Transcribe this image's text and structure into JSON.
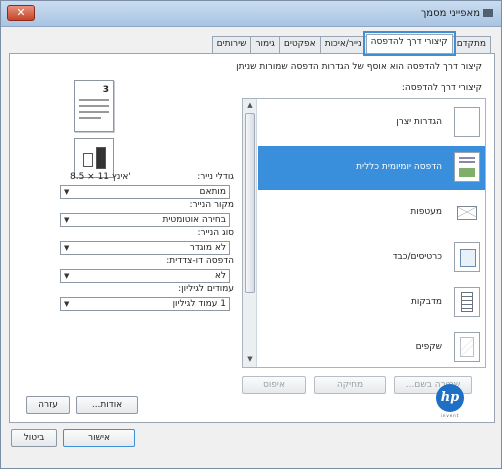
{
  "window": {
    "title": "מאפייני מסמך",
    "close_label": "✕"
  },
  "tabs": [
    {
      "label": "מתקדם"
    },
    {
      "label": "קיצורי דרך להדפסה",
      "active": true
    },
    {
      "label": "נייר/איכות"
    },
    {
      "label": "אפקטים"
    },
    {
      "label": "גימור"
    },
    {
      "label": "שירותים"
    }
  ],
  "panel": {
    "description": "קיצור דרך להדפסה הוא אוסף של הגדרות הדפסה שמורות שניתן",
    "list_label": "קיצורי דרך להדפסה:"
  },
  "shortcuts": [
    {
      "label": "הגדרות יצרן",
      "icon": "blank-page-icon"
    },
    {
      "label": "הדפסה יומיומית כללית",
      "icon": "general-print-icon",
      "selected": true
    },
    {
      "label": "מעטפות",
      "icon": "envelope-icon"
    },
    {
      "label": "כרטיסים/כבד",
      "icon": "cards-icon"
    },
    {
      "label": "מדבקות",
      "icon": "labels-icon"
    },
    {
      "label": "שקפים",
      "icon": "transparency-icon"
    }
  ],
  "buttons": {
    "save_as": "שמירה בשם...",
    "delete": "מחיקה",
    "reset": "איפוס",
    "about": "אודות...",
    "help": "עזרה",
    "ok": "אישור",
    "cancel": "ביטול"
  },
  "preview": {
    "page_number": "3"
  },
  "fields": {
    "paper_size_label": "גודלי נייר:",
    "paper_size_value": "8.5 × 11 אינץ'",
    "paper_size_select": "מותאם",
    "paper_source_label": "מקור הנייר:",
    "paper_source_value": "בחירה אוטומטית",
    "paper_type_label": "סוג הנייר:",
    "paper_type_value": "לא מוגדר",
    "duplex_label": "הדפסה דו-צדדית:",
    "duplex_value": "לא",
    "pages_per_sheet_label": "עמודים לגיליון:",
    "pages_per_sheet_value": "1 עמוד לגיליון"
  },
  "brand": {
    "logo_text": "hp",
    "tagline": "invent"
  },
  "colors": {
    "selection": "#3a8fdc",
    "tab_highlight": "#3f8fd6",
    "hp_blue": "#1f6fc5"
  }
}
